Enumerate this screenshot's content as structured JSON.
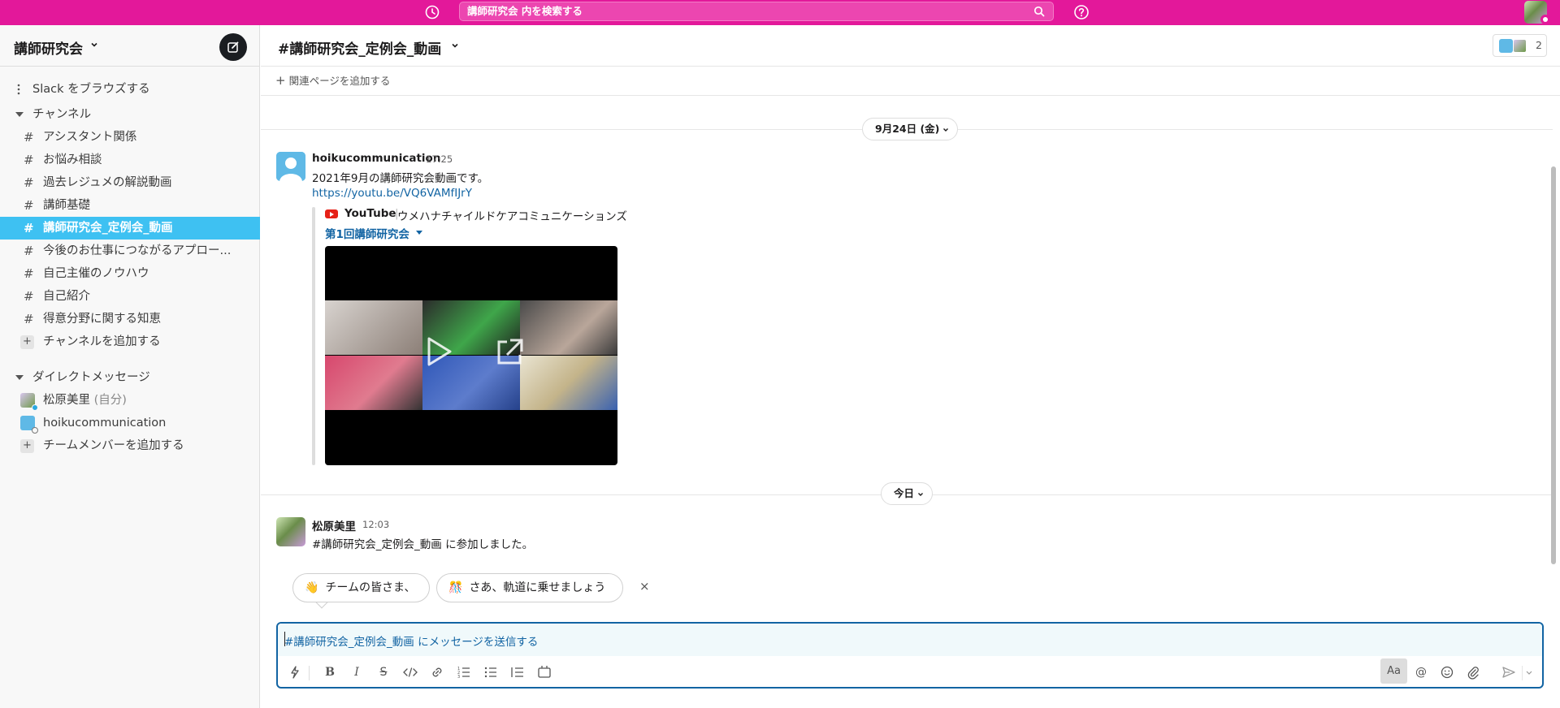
{
  "topbar": {
    "search_placeholder": "講師研究会 内を検索する",
    "accent_color": "#e3189a",
    "history_icon": "clock-icon",
    "help_icon": "help-circle-icon"
  },
  "sidebar": {
    "workspace_name": "講師研究会",
    "browse_label": "Slack をブラウズする",
    "channels_section": "チャンネル",
    "channels": [
      {
        "label": "アシスタント関係"
      },
      {
        "label": "お悩み相談"
      },
      {
        "label": "過去レジュメの解説動画"
      },
      {
        "label": "講師基礎"
      },
      {
        "label": "講師研究会_定例会_動画",
        "active": true
      },
      {
        "label": "今後のお仕事につながるアプロー..."
      },
      {
        "label": "自己主催のノウハウ"
      },
      {
        "label": "自己紹介"
      },
      {
        "label": "得意分野に関する知恵"
      }
    ],
    "hash": "#",
    "add_channel_label": "チャンネルを追加する",
    "dm_section": "ダイレクトメッセージ",
    "dms": [
      {
        "name": "松原美里",
        "suffix": "(自分)"
      },
      {
        "name": "hoikucommunication",
        "suffix": ""
      }
    ],
    "add_member_label": "チームメンバーを追加する",
    "active_color": "#3ec1f2"
  },
  "channel": {
    "title": "#講師研究会_定例会_動画",
    "member_count": "2",
    "add_page_label": "関連ページを追加する"
  },
  "messages": {
    "date_1": "9月24日 (金)",
    "msg_1": {
      "sender": "hoikucommunication",
      "time": "17:25",
      "text": "2021年9月の講師研究会動画です。",
      "link": "https://youtu.be/VQ6VAMfIJrY",
      "attachment": {
        "service": "YouTube",
        "separator": "|",
        "channel": "ウメハナチャイルドケアコミュニケーションズ",
        "title": "第1回講師研究会"
      }
    },
    "date_2": "今日",
    "msg_2": {
      "sender": "松原美里",
      "time": "12:03",
      "text": "#講師研究会_定例会_動画 に参加しました。"
    }
  },
  "suggestions": {
    "chip_1": {
      "emoji": "👋",
      "label": "チームの皆さま、"
    },
    "chip_2": {
      "emoji": "🎊",
      "label": "さあ、軌道に乗せましょう"
    },
    "close": "×"
  },
  "composer": {
    "placeholder": "#講師研究会_定例会_動画 にメッセージを送信する",
    "toolbar": {
      "bold": "B",
      "italic": "I",
      "strike": "S",
      "aa": "Aa",
      "at": "@"
    },
    "border_color": "#1264a3"
  }
}
